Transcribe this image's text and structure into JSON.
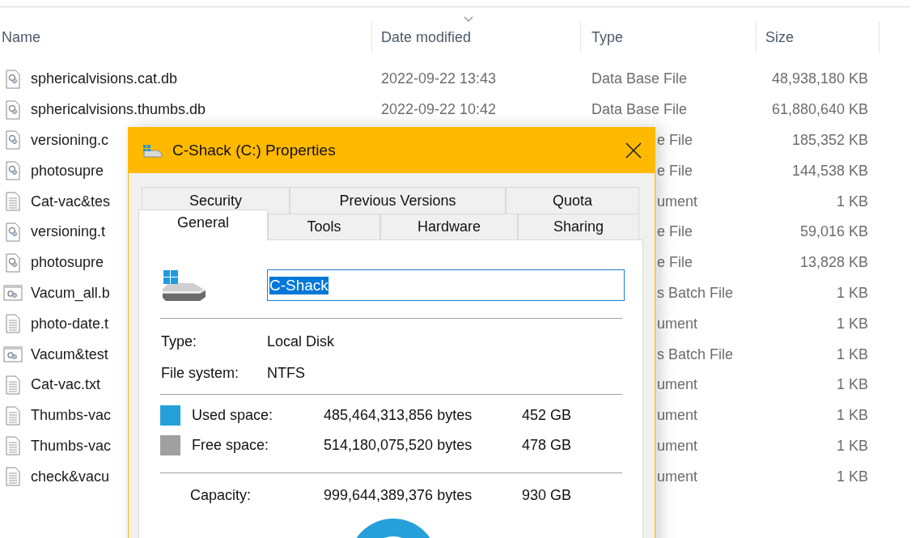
{
  "explorer": {
    "columns": [
      {
        "label": "Name",
        "sorted": false
      },
      {
        "label": "Date modified",
        "sorted": true
      },
      {
        "label": "Type",
        "sorted": false
      },
      {
        "label": "Size",
        "sorted": false
      }
    ],
    "rows": [
      {
        "kind": "database",
        "name": "sphericalvisions.cat.db",
        "date": "2022-09-22 13:43",
        "type": "Data Base File",
        "size": "48,938,180 KB"
      },
      {
        "kind": "database",
        "name": "sphericalvisions.thumbs.db",
        "date": "2022-09-22 10:42",
        "type": "Data Base File",
        "size": "61,880,640 KB"
      },
      {
        "kind": "database",
        "name": "versioning.c",
        "type": "e File",
        "size": "185,352 KB"
      },
      {
        "kind": "database",
        "name": "photosupre",
        "type": "e File",
        "size": "144,538 KB"
      },
      {
        "kind": "text",
        "name": "Cat-vac&tes",
        "type": "ument",
        "size": "1 KB"
      },
      {
        "kind": "database",
        "name": "versioning.t",
        "type": "e File",
        "size": "59,016 KB"
      },
      {
        "kind": "database",
        "name": "photosupre",
        "type": "e File",
        "size": "13,828 KB"
      },
      {
        "kind": "batch",
        "name": "Vacum_all.b",
        "type": "s Batch File",
        "size": "1 KB"
      },
      {
        "kind": "text",
        "name": "photo-date.t",
        "type": "ument",
        "size": "1 KB"
      },
      {
        "kind": "batch",
        "name": "Vacum&test",
        "type": "s Batch File",
        "size": "1 KB"
      },
      {
        "kind": "text",
        "name": "Cat-vac.txt",
        "type": "ument",
        "size": "1 KB"
      },
      {
        "kind": "text",
        "name": "Thumbs-vac",
        "type": "ument",
        "size": "1 KB"
      },
      {
        "kind": "text",
        "name": "Thumbs-vac",
        "type": "ument",
        "size": "1 KB"
      },
      {
        "kind": "text",
        "name": "check&vacu",
        "type": "ument",
        "size": "1 KB"
      }
    ]
  },
  "dialog": {
    "title": "C-Shack (C:) Properties",
    "tabs": [
      [
        {
          "label": "Security",
          "selected": false
        },
        {
          "label": "Previous Versions",
          "selected": false
        },
        {
          "label": "Quota",
          "selected": false
        }
      ],
      [
        {
          "label": "General",
          "selected": true
        },
        {
          "label": "Tools",
          "selected": false
        },
        {
          "label": "Hardware",
          "selected": false
        },
        {
          "label": "Sharing",
          "selected": false
        }
      ]
    ],
    "name_field": {
      "value": "C-Shack",
      "text_selected": true
    },
    "info": [
      {
        "label": "Type:",
        "value": "Local Disk"
      },
      {
        "label": "File system:",
        "value": "NTFS"
      }
    ],
    "space": [
      {
        "label": "Used space:",
        "bytes": "485,464,313,856 bytes",
        "size": "452 GB",
        "color": "#26a0da"
      },
      {
        "label": "Free space:",
        "bytes": "514,180,075,520 bytes",
        "size": "478 GB",
        "color": "#a0a0a0"
      }
    ],
    "capacity": {
      "label": "Capacity:",
      "bytes": "999,644,389,376 bytes",
      "size": "930 GB"
    }
  }
}
